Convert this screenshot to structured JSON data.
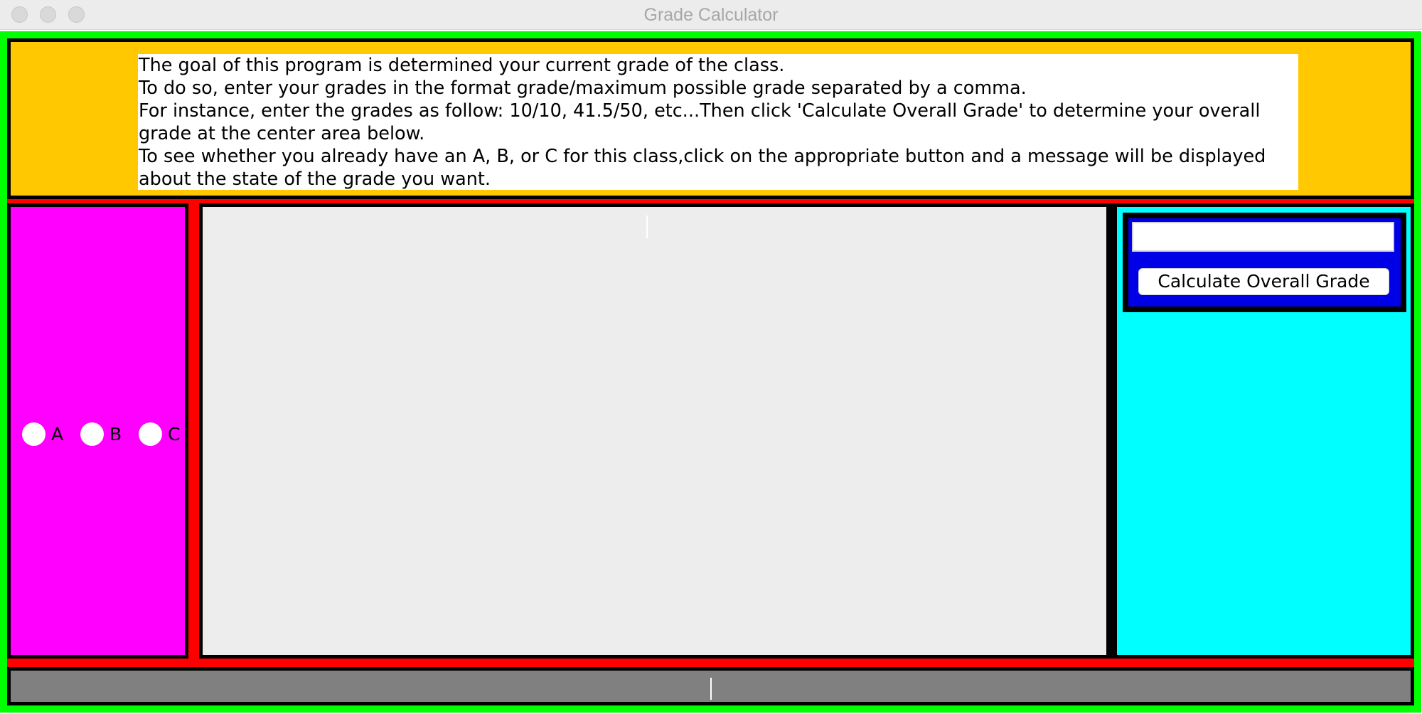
{
  "window": {
    "title": "Grade Calculator"
  },
  "colors": {
    "frame": "#00ff00",
    "separator": "#ff0000",
    "top_panel": "#ffc800",
    "left_panel": "#ff00ff",
    "center_area": "#ededed",
    "right_panel": "#00ffff",
    "input_box": "#0000e6",
    "bottom_panel": "#808080"
  },
  "instructions": {
    "lines": [
      "The goal of this program is determined your current grade of the class.",
      "To do so, enter your grades in the format grade/maximum possible grade separated by a comma.",
      "For instance, enter the grades as follow: 10/10, 41.5/50, etc...Then click 'Calculate Overall Grade' to determine your overall grade at the center area below.",
      "To see whether you already have an A, B, or C for this class,click on the appropriate button and a message will be displayed about the state of the grade you want."
    ]
  },
  "grade_options": {
    "a_label": "A",
    "b_label": "B",
    "c_label": "C"
  },
  "center": {
    "output_text": ""
  },
  "calculator": {
    "input_value": "",
    "button_label": "Calculate Overall Grade"
  },
  "bottom": {
    "status_text": ""
  }
}
